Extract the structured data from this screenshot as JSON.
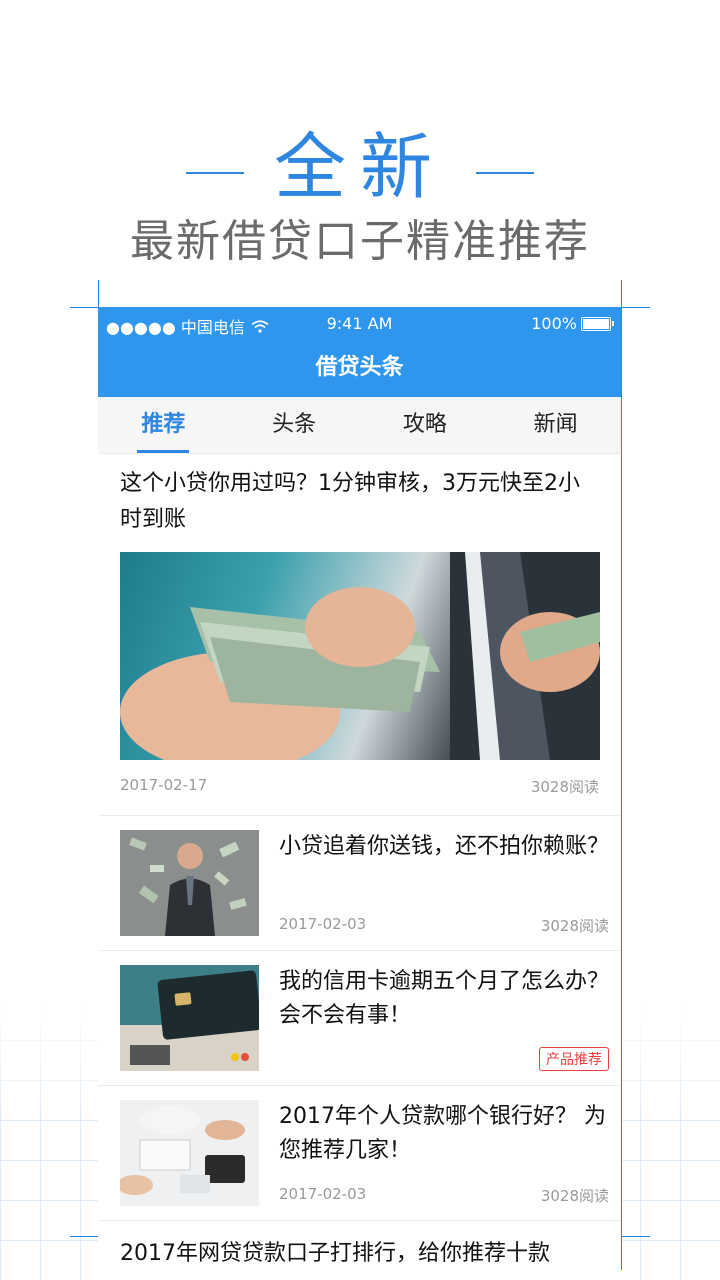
{
  "banner": {
    "headline": "全新",
    "subline": "最新借贷口子精准推荐"
  },
  "status_bar": {
    "carrier": "●●●●● 中国电信",
    "time": "9:41 AM",
    "battery": "100%"
  },
  "navbar": {
    "title": "借贷头条"
  },
  "tabs": [
    {
      "label": "推荐",
      "active": true
    },
    {
      "label": "头条",
      "active": false
    },
    {
      "label": "攻略",
      "active": false
    },
    {
      "label": "新闻",
      "active": false
    }
  ],
  "articles": [
    {
      "title": "这个小贷你用过吗？1分钟审核，3万元快至2小时到账",
      "date": "2017-02-17",
      "reads": "3028阅读",
      "image": "cash-handover-photo"
    },
    {
      "title": "小贷追着你送钱，还不拍你赖账？",
      "date": "2017-02-03",
      "reads": "3028阅读",
      "image": "money-rain-man-photo"
    },
    {
      "title": "我的信用卡逾期五个月了怎么办？会不会有事！",
      "tag": "产品推荐",
      "image": "credit-card-photo"
    },
    {
      "title": "2017年个人贷款哪个银行好？ 为您推荐几家！",
      "date": "2017-02-03",
      "reads": "3028阅读",
      "image": "office-desk-photo"
    },
    {
      "title": "2017年网贷贷款口子打排行，给你推荐十款"
    }
  ],
  "colors": {
    "accent": "#2f86e0",
    "navbar": "#2f96ee",
    "tag": "#e84040"
  },
  "icons": [
    "wifi-icon",
    "battery-icon"
  ]
}
